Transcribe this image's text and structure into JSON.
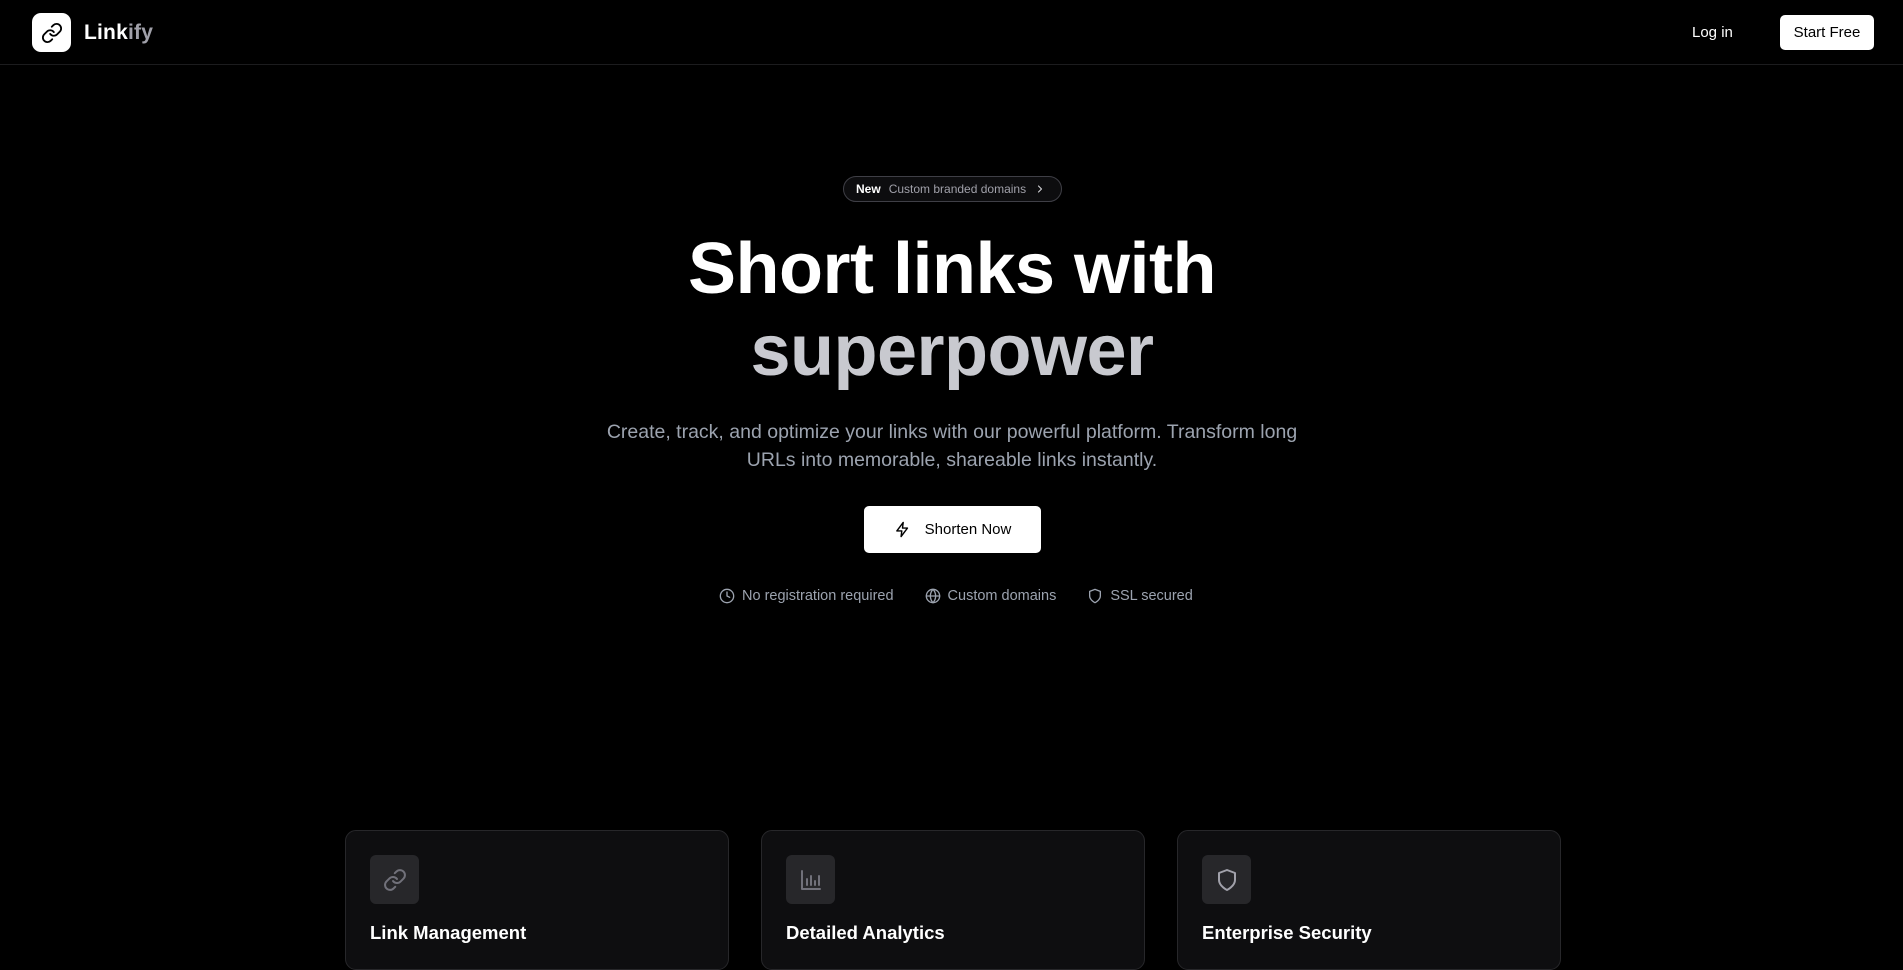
{
  "nav": {
    "brand_part1": "Link",
    "brand_part2": "ify",
    "brand_icon": "link-icon",
    "login_label": "Log in",
    "start_label": "Start Free"
  },
  "hero": {
    "badge_new": "New",
    "badge_text": "Custom branded domains",
    "title_line1": "Short links with",
    "title_line2": "superpower",
    "subtitle": "Create, track, and optimize your links with our powerful platform. Transform long URLs into memorable, shareable links instantly.",
    "cta_label": "Shorten Now",
    "cta_icon": "lightning-icon",
    "inline_features": [
      {
        "icon": "clock-icon",
        "label": "No registration required"
      },
      {
        "icon": "globe-icon",
        "label": "Custom domains"
      },
      {
        "icon": "shield-icon",
        "label": "SSL secured"
      }
    ]
  },
  "cards": [
    {
      "icon": "link-icon",
      "title": "Link Management"
    },
    {
      "icon": "bar-chart-icon",
      "title": "Detailed Analytics"
    },
    {
      "icon": "shield-icon",
      "title": "Enterprise Security"
    }
  ],
  "colors": {
    "background": "#000000",
    "text": "#ffffff",
    "muted": "#9ca3af",
    "title_second_line": "#c8c9cf",
    "card_bg": "#0e0e10",
    "card_border": "#27272a"
  }
}
